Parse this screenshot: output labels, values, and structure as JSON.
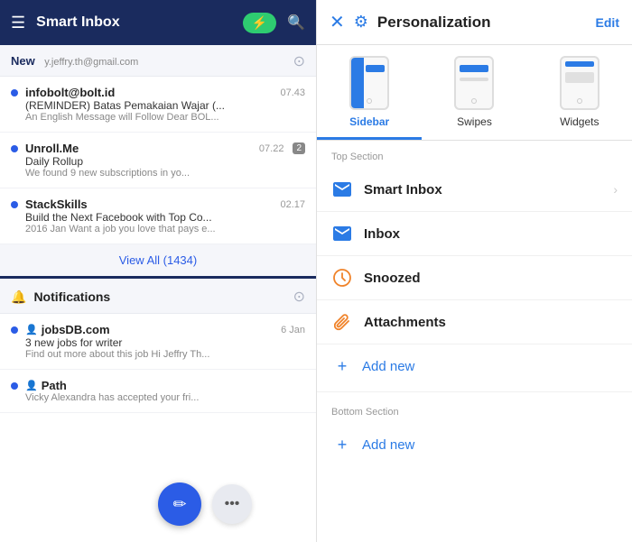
{
  "left": {
    "topBar": {
      "title": "Smart Inbox",
      "boltLabel": "⚡"
    },
    "newSection": {
      "label": "New",
      "sublabel": "y.jeffry.th@gmail.com"
    },
    "mailItems": [
      {
        "sender": "infobolt@bolt.id",
        "time": "07.43",
        "subject": "(REMINDER) Batas Pemakaian Wajar (...",
        "preview": "An English Message will Follow Dear BOL..."
      },
      {
        "sender": "Unroll.Me",
        "time": "07.22",
        "subject": "Daily Rollup",
        "preview": "We found 9 new subscriptions in yo...",
        "badge": "2"
      },
      {
        "sender": "StackSkills",
        "time": "02.17",
        "subject": "Build the Next Facebook with Top Co...",
        "preview": "2016 Jan Want a job you love that pays e..."
      }
    ],
    "viewAll": "View All (1434)",
    "notifications": {
      "label": "Notifications",
      "items": [
        {
          "sender": "jobsDB.com",
          "time": "6 Jan",
          "subject": "3 new jobs for writer",
          "preview": "Find out more about this job Hi Jeffry Th..."
        },
        {
          "sender": "Path",
          "time": "",
          "subject": "",
          "preview": "Vicky Alexandra has accepted your fri..."
        }
      ]
    }
  },
  "right": {
    "header": {
      "title": "Personalization",
      "editLabel": "Edit"
    },
    "tabs": [
      {
        "label": "Sidebar",
        "active": true
      },
      {
        "label": "Swipes",
        "active": false
      },
      {
        "label": "Widgets",
        "active": false
      }
    ],
    "topSection": {
      "label": "Top Section",
      "items": [
        {
          "icon": "✉",
          "label": "Smart Inbox",
          "hasChevron": true,
          "iconColor": "#2b7be5"
        },
        {
          "icon": "✉",
          "label": "Inbox",
          "hasChevron": false,
          "iconColor": "#2b7be5"
        },
        {
          "icon": "🕐",
          "label": "Snoozed",
          "hasChevron": false,
          "iconColor": "#f0832a"
        },
        {
          "icon": "📎",
          "label": "Attachments",
          "hasChevron": false,
          "iconColor": "#f0832a"
        }
      ],
      "addNew": "Add new"
    },
    "bottomSection": {
      "label": "Bottom Section",
      "addNew": "Add new"
    }
  }
}
